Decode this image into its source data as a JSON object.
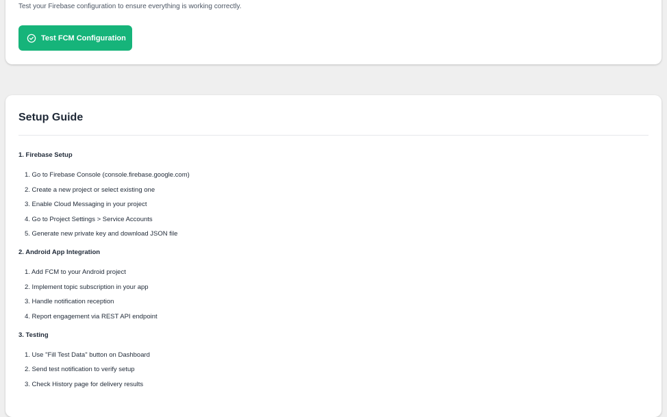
{
  "test_card": {
    "description": "Test your Firebase configuration to ensure everything is working correctly.",
    "button_label": "Test FCM Configuration",
    "button_color": "#16b47a"
  },
  "guide": {
    "title": "Setup Guide",
    "sections": [
      {
        "title": "1. Firebase Setup",
        "steps": [
          "1. Go to Firebase Console (console.firebase.google.com)",
          "2. Create a new project or select existing one",
          "3. Enable Cloud Messaging in your project",
          "4. Go to Project Settings > Service Accounts",
          "5. Generate new private key and download JSON file"
        ]
      },
      {
        "title": "2. Android App Integration",
        "steps": [
          "1. Add FCM to your Android project",
          "2. Implement topic subscription in your app",
          "3. Handle notification reception",
          "4. Report engagement via REST API endpoint"
        ]
      },
      {
        "title": "3. Testing",
        "steps": [
          "1. Use \"Fill Test Data\" button on Dashboard",
          "2. Send test notification to verify setup",
          "3. Check History page for delivery results"
        ]
      }
    ]
  }
}
